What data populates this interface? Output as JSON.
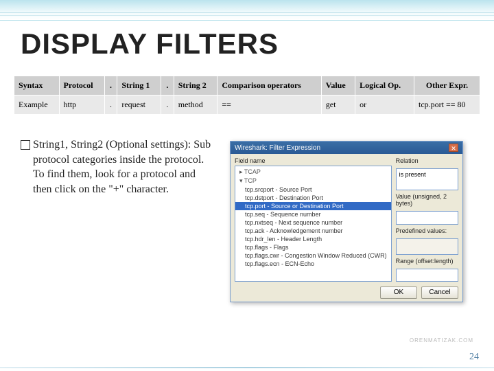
{
  "title": "DISPLAY FILTERS",
  "table": {
    "headers": [
      "Syntax",
      "Protocol",
      ".",
      "String 1",
      ".",
      "String 2",
      "Comparison operators",
      "Value",
      "Logical Op.",
      "Other Expr."
    ],
    "row": [
      "Example",
      "http",
      ".",
      "request",
      ".",
      "method",
      "==",
      "get",
      "or",
      "tcp.port == 80"
    ]
  },
  "body": "String1, String2 (Optional settings): Sub protocol categories inside the protocol. To find them, look for a protocol and then click on the \"+\" character.",
  "dialog": {
    "title": "Wireshark: Filter Expression",
    "field_label": "Field name",
    "relation_label": "Relation",
    "relation_value": "is present",
    "value_label": "Value (unsigned, 2 bytes)",
    "range_label": "Range (offset:length)",
    "predef_label": "Predefined values:",
    "ok": "OK",
    "cancel": "Cancel",
    "fields": {
      "tcap": "TCAP",
      "tcp": "TCP",
      "srcport": "tcp.srcport - Source Port",
      "dstport_hdr": "tcp.dstport - Destination Port",
      "port_sel": "tcp.port - Source or Destination Port",
      "seq": "tcp.seq - Sequence number",
      "nxtseq": "tcp.nxtseq - Next sequence number",
      "ack": "tcp.ack - Acknowledgement number",
      "hdrlen": "tcp.hdr_len - Header Length",
      "flags": "tcp.flags - Flags",
      "cwr": "tcp.flags.cwr - Congestion Window Reduced (CWR)",
      "ecn": "tcp.flags.ecn - ECN-Echo"
    }
  },
  "page_number": "24",
  "watermark": "ORENMATIZAK.COM"
}
